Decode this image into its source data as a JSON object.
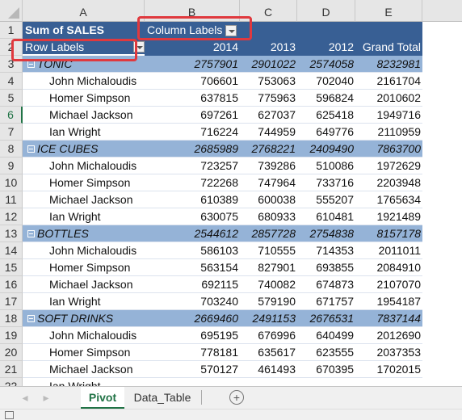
{
  "columns": [
    "A",
    "B",
    "C",
    "D",
    "E"
  ],
  "pivot": {
    "value_field": "Sum of SALES",
    "column_labels": "Column Labels",
    "row_labels": "Row Labels",
    "years": [
      "2014",
      "2013",
      "2012"
    ],
    "grand_total_label": "Grand Total",
    "groups": [
      {
        "name": "TONIC",
        "totals": [
          "2757901",
          "2901022",
          "2574058",
          "8232981"
        ],
        "rows": [
          {
            "name": "John Michaloudis",
            "values": [
              "706601",
              "753063",
              "702040",
              "2161704"
            ]
          },
          {
            "name": "Homer Simpson",
            "values": [
              "637815",
              "775963",
              "596824",
              "2010602"
            ]
          },
          {
            "name": "Michael Jackson",
            "values": [
              "697261",
              "627037",
              "625418",
              "1949716"
            ]
          },
          {
            "name": "Ian Wright",
            "values": [
              "716224",
              "744959",
              "649776",
              "2110959"
            ]
          }
        ]
      },
      {
        "name": "ICE CUBES",
        "totals": [
          "2685989",
          "2768221",
          "2409490",
          "7863700"
        ],
        "rows": [
          {
            "name": "John Michaloudis",
            "values": [
              "723257",
              "739286",
              "510086",
              "1972629"
            ]
          },
          {
            "name": "Homer Simpson",
            "values": [
              "722268",
              "747964",
              "733716",
              "2203948"
            ]
          },
          {
            "name": "Michael Jackson",
            "values": [
              "610389",
              "600038",
              "555207",
              "1765634"
            ]
          },
          {
            "name": "Ian Wright",
            "values": [
              "630075",
              "680933",
              "610481",
              "1921489"
            ]
          }
        ]
      },
      {
        "name": "BOTTLES",
        "totals": [
          "2544612",
          "2857728",
          "2754838",
          "8157178"
        ],
        "rows": [
          {
            "name": "John Michaloudis",
            "values": [
              "586103",
              "710555",
              "714353",
              "2011011"
            ]
          },
          {
            "name": "Homer Simpson",
            "values": [
              "563154",
              "827901",
              "693855",
              "2084910"
            ]
          },
          {
            "name": "Michael Jackson",
            "values": [
              "692115",
              "740082",
              "674873",
              "2107070"
            ]
          },
          {
            "name": "Ian Wright",
            "values": [
              "703240",
              "579190",
              "671757",
              "1954187"
            ]
          }
        ]
      },
      {
        "name": "SOFT DRINKS",
        "totals": [
          "2669460",
          "2491153",
          "2676531",
          "7837144"
        ],
        "rows": [
          {
            "name": "John Michaloudis",
            "values": [
              "695195",
              "676996",
              "640499",
              "2012690"
            ]
          },
          {
            "name": "Homer Simpson",
            "values": [
              "778181",
              "635617",
              "623555",
              "2037353"
            ]
          },
          {
            "name": "Michael Jackson",
            "values": [
              "570127",
              "461493",
              "670395",
              "1702015"
            ]
          },
          {
            "name": "Ian Wright",
            "values": [
              "",
              "",
              "",
              ""
            ]
          }
        ]
      }
    ]
  },
  "selected_row": "6",
  "sheet_tabs": [
    {
      "label": "Pivot",
      "active": true
    },
    {
      "label": "Data_Table",
      "active": false
    }
  ],
  "colors": {
    "header": "#385f94",
    "group": "#95b3d7",
    "highlight": "#e0393e",
    "active_tab": "#217346"
  }
}
